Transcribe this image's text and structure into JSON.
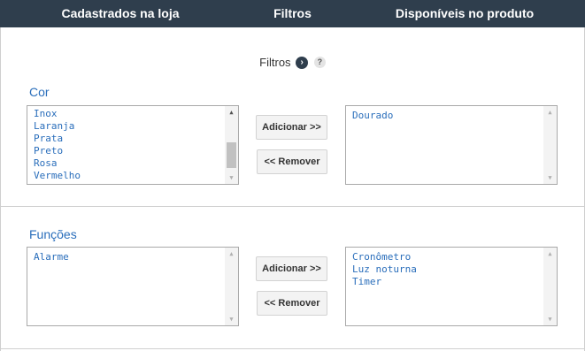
{
  "header": {
    "col_registered": "Cadastrados na loja",
    "col_filters": "Filtros",
    "col_available": "Disponíveis no produto"
  },
  "filter_section": {
    "title": "Filtros",
    "arrow_icon": "›",
    "help_icon": "?"
  },
  "groups": [
    {
      "label": "Cor",
      "available_options": [
        "Inox",
        "Laranja",
        "Prata",
        "Preto",
        "Rosa",
        "Vermelho"
      ],
      "selected_options": [
        "Dourado"
      ],
      "add_label": "Adicionar >>",
      "remove_label": "<< Remover",
      "available_scroll_position": 0.9
    },
    {
      "label": "Funções",
      "available_options": [
        "Alarme"
      ],
      "selected_options": [
        "Cronômetro",
        "Luz noturna",
        "Timer"
      ],
      "add_label": "Adicionar >>",
      "remove_label": "<< Remover"
    }
  ],
  "colors": {
    "header_bg": "#2f3e4d",
    "label_blue": "#2a6ebb",
    "option_blue": "#2a6ebb"
  }
}
